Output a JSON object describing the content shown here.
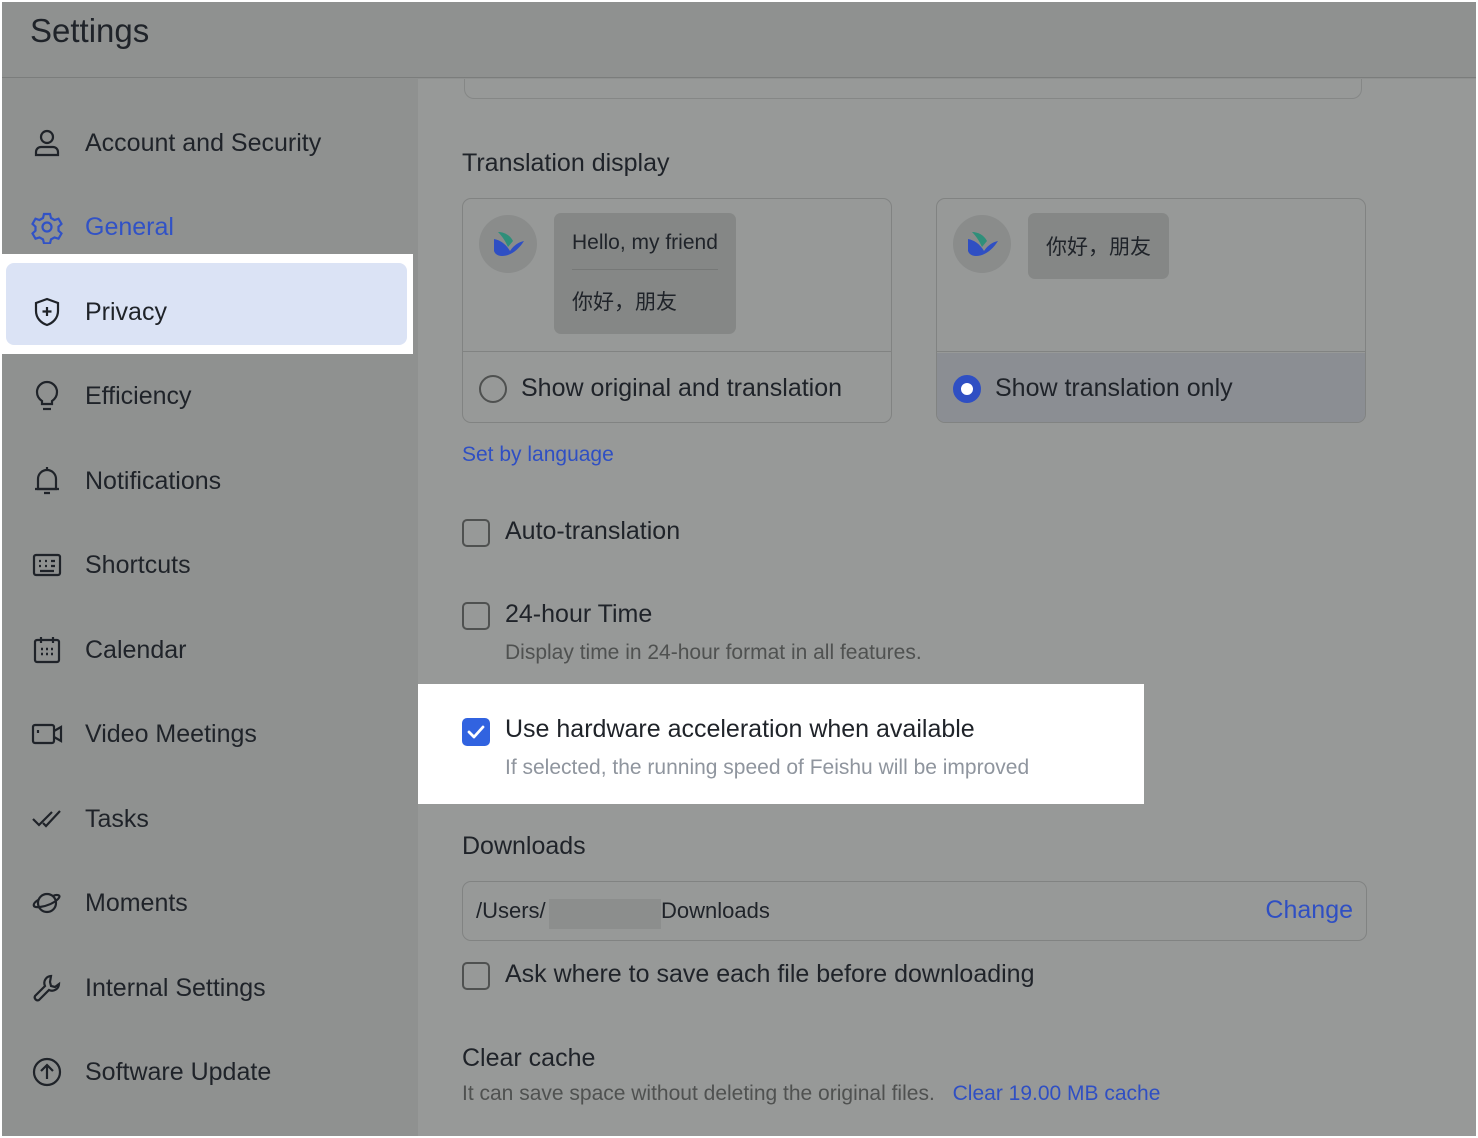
{
  "window": {
    "title": "Settings"
  },
  "sidebar": {
    "items": [
      {
        "label": "Account and Security",
        "icon": "person-icon"
      },
      {
        "label": "General",
        "icon": "gear-icon",
        "active": true
      },
      {
        "label": "Privacy",
        "icon": "shield-plus-icon"
      },
      {
        "label": "Efficiency",
        "icon": "lightbulb-icon"
      },
      {
        "label": "Notifications",
        "icon": "bell-icon"
      },
      {
        "label": "Shortcuts",
        "icon": "keyboard-icon"
      },
      {
        "label": "Calendar",
        "icon": "calendar-icon"
      },
      {
        "label": "Video Meetings",
        "icon": "video-camera-icon"
      },
      {
        "label": "Tasks",
        "icon": "double-check-icon"
      },
      {
        "label": "Moments",
        "icon": "planet-icon"
      },
      {
        "label": "Internal Settings",
        "icon": "wrench-icon"
      },
      {
        "label": "Software Update",
        "icon": "arrow-up-circle-icon"
      }
    ]
  },
  "translation": {
    "section_title": "Translation display",
    "option_both": {
      "original": "Hello, my friend",
      "translated": "你好，朋友",
      "label": "Show original and translation",
      "selected": false
    },
    "option_only": {
      "translated": "你好，朋友",
      "label": "Show translation only",
      "selected": true
    },
    "set_by_language": "Set by language"
  },
  "options": {
    "auto_translation": {
      "label": "Auto-translation",
      "checked": false
    },
    "hour24": {
      "label": "24-hour Time",
      "description": "Display time in 24-hour format in all features.",
      "checked": false
    },
    "hardware_accel": {
      "label": "Use hardware acceleration when available",
      "description": "If selected, the running speed of Feishu will be improved",
      "checked": true
    }
  },
  "downloads": {
    "section_title": "Downloads",
    "path_prefix": "/Users/",
    "path_suffix": "Downloads",
    "change_label": "Change",
    "ask_label": "Ask where to save each file before downloading",
    "ask_checked": false
  },
  "cache": {
    "section_title": "Clear cache",
    "description": "It can save space without deleting the original files.",
    "clear_label": "Clear 19.00 MB cache"
  },
  "colors": {
    "accent": "#2f4fc3",
    "overlay": "#8f9190",
    "highlight": "#ffffff"
  }
}
